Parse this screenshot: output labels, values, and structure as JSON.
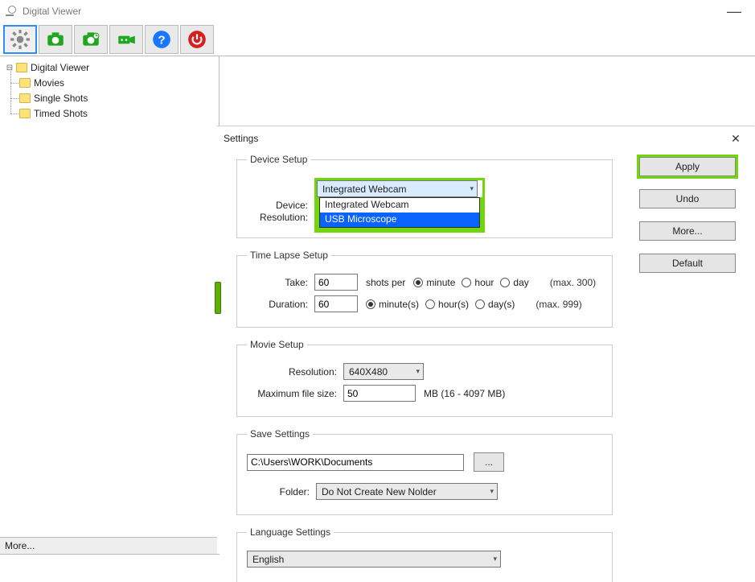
{
  "titlebar": {
    "title": "Digital Viewer"
  },
  "toolbar": {
    "buttons": [
      "settings",
      "capture",
      "timed-capture",
      "video-record",
      "help",
      "power"
    ]
  },
  "tree": {
    "root": "Digital Viewer",
    "children": [
      "Movies",
      "Single Shots",
      "Timed Shots"
    ]
  },
  "more_bar": "More...",
  "settings": {
    "title": "Settings",
    "device_setup": {
      "legend": "Device Setup",
      "device_label": "Device:",
      "device_value": "Integrated Webcam",
      "device_options": [
        "Integrated Webcam",
        "USB Microscope"
      ],
      "device_selected_index": 1,
      "resolution_label": "Resolution:"
    },
    "time_lapse": {
      "legend": "Time Lapse Setup",
      "take_label": "Take:",
      "take_value": "60",
      "shots_per": "shots per",
      "unit_options": [
        "minute",
        "hour",
        "day"
      ],
      "unit_selected": "minute",
      "take_max": "(max. 300)",
      "duration_label": "Duration:",
      "duration_value": "60",
      "duration_units": [
        "minute(s)",
        "hour(s)",
        "day(s)"
      ],
      "duration_selected": "minute(s)",
      "duration_max": "(max. 999)"
    },
    "movie_setup": {
      "legend": "Movie Setup",
      "resolution_label": "Resolution:",
      "resolution_value": "640X480",
      "filesize_label": "Maximum file size:",
      "filesize_value": "50",
      "filesize_hint": "MB (16 - 4097 MB)"
    },
    "save": {
      "legend": "Save Settings",
      "path": "C:\\Users\\WORK\\Documents",
      "browse": "...",
      "folder_label": "Folder:",
      "folder_value": "Do Not Create New Nolder"
    },
    "language": {
      "legend": "Language Settings",
      "value": "English"
    },
    "buttons": {
      "apply": "Apply",
      "undo": "Undo",
      "more": "More...",
      "default": "Default"
    }
  }
}
